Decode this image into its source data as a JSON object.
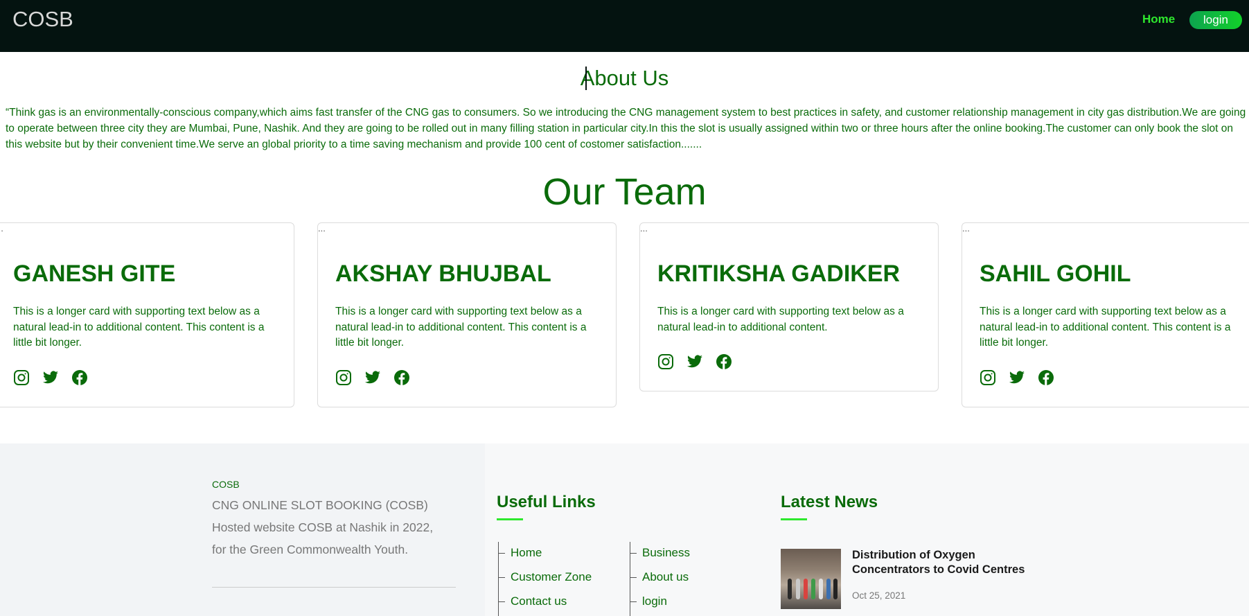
{
  "nav": {
    "brand": "COSB",
    "home": "Home",
    "login": "login"
  },
  "about": {
    "title": "About Us",
    "text": "“Think gas is an environmentally-conscious company,which aims fast transfer of the CNG gas to consumers. So we introducing the CNG management system to best practices in safety, and customer relationship management in city gas distribution.We are going to operate between three city they are Mumbai, Pune, Nashik. And they are going to be rolled out in many filling station in particular city.In this the slot is usually assigned within two or three hours after the online booking.The customer can only book the slot on this website but by their convenient time.We serve an global priority to a time saving mechanism and provide 100 cent of costomer satisfaction......."
  },
  "team": {
    "title": "Our Team",
    "img_alt": "...",
    "members": [
      {
        "name": "GANESH GITE",
        "text": "This is a longer card with supporting text below as a natural lead-in to additional content. This content is a little bit longer."
      },
      {
        "name": "AKSHAY BHUJBAL",
        "text": "This is a longer card with supporting text below as a natural lead-in to additional content. This content is a little bit longer."
      },
      {
        "name": "KRITIKSHA GADIKER",
        "text": "This is a longer card with supporting text below as a natural lead-in to additional content."
      },
      {
        "name": "SAHIL GOHIL",
        "text": "This is a longer card with supporting text below as a natural lead-in to additional content. This content is a little bit longer."
      }
    ],
    "social_icons": [
      "instagram-icon",
      "twitter-icon",
      "facebook-icon"
    ]
  },
  "footer": {
    "brand": "COSB",
    "description": "CNG ONLINE SLOT BOOKING (COSB) Hosted website COSB at Nashik in 2022, for the Green Commonwealth Youth.",
    "useful_links_title": "Useful Links",
    "links_left": [
      "Home",
      "Customer Zone",
      "Contact us"
    ],
    "links_right": [
      "Business",
      "About us",
      "login"
    ],
    "latest_news_title": "Latest News",
    "news": {
      "title": "Distribution of Oxygen Concentrators to Covid Centres",
      "date": "Oct 25, 2021"
    }
  },
  "colors": {
    "navbar_bg": "#041310",
    "text_green": "#0a6b0a",
    "accent_green": "#2ee82e",
    "footer_bg": "#f2f4f6"
  }
}
